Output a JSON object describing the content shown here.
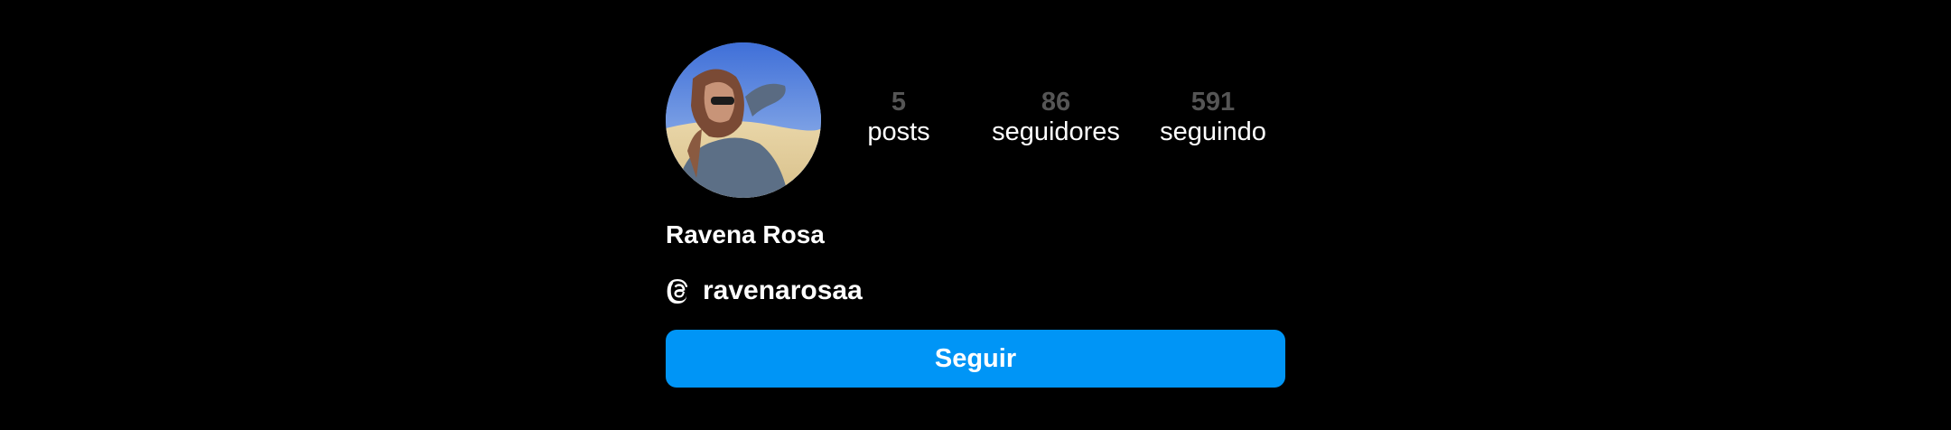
{
  "profile": {
    "display_name": "Ravena Rosa",
    "avatar_icon": "profile-photo",
    "stats": {
      "posts": {
        "value": "5",
        "label": "posts"
      },
      "followers": {
        "value": "86",
        "label": "seguidores"
      },
      "following": {
        "value": "591",
        "label": "seguindo"
      }
    },
    "threads": {
      "icon": "threads-icon",
      "handle": "ravenarosaa"
    },
    "follow_button": {
      "label": "Seguir",
      "color": "#0095f6"
    }
  },
  "colors": {
    "background": "#000000",
    "stat_value": "#555555",
    "text": "#ffffff"
  }
}
